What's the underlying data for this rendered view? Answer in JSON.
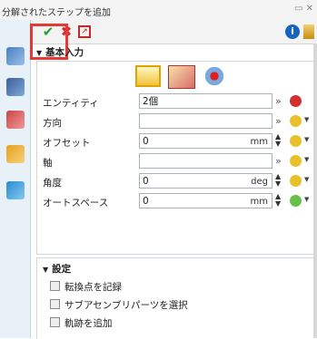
{
  "window": {
    "title": "分解されたステップを追加",
    "controls": "▭ ✕"
  },
  "toolbar": {
    "ok_icon": "check-icon",
    "cancel_icon": "x-icon",
    "apply_icon": "apply-arrow-icon",
    "info_icon": "info-icon"
  },
  "basic_input": {
    "header": "基本入力",
    "mode_icons": [
      "move-icon",
      "rotate-icon",
      "explode-icon"
    ],
    "fields": [
      {
        "label": "エンティティ",
        "value": "2個",
        "unit": ""
      },
      {
        "label": "方向",
        "value": "",
        "unit": ""
      },
      {
        "label": "オフセット",
        "value": "0",
        "unit": "mm"
      },
      {
        "label": "軸",
        "value": "",
        "unit": ""
      },
      {
        "label": "角度",
        "value": "0",
        "unit": "deg"
      },
      {
        "label": "オートスペース",
        "value": "0",
        "unit": "mm"
      }
    ]
  },
  "settings": {
    "header": "設定",
    "options": [
      {
        "label": "転換点を記録",
        "checked": false
      },
      {
        "label": "サブアセンブリパーツを選択",
        "checked": false
      },
      {
        "label": "軌跡を追加",
        "checked": false
      }
    ]
  },
  "colors": {
    "highlight": "#e53935",
    "ok_green": "#2e9e35",
    "cancel_red": "#d32f2f",
    "pin_yellow": "#e8c12a"
  }
}
